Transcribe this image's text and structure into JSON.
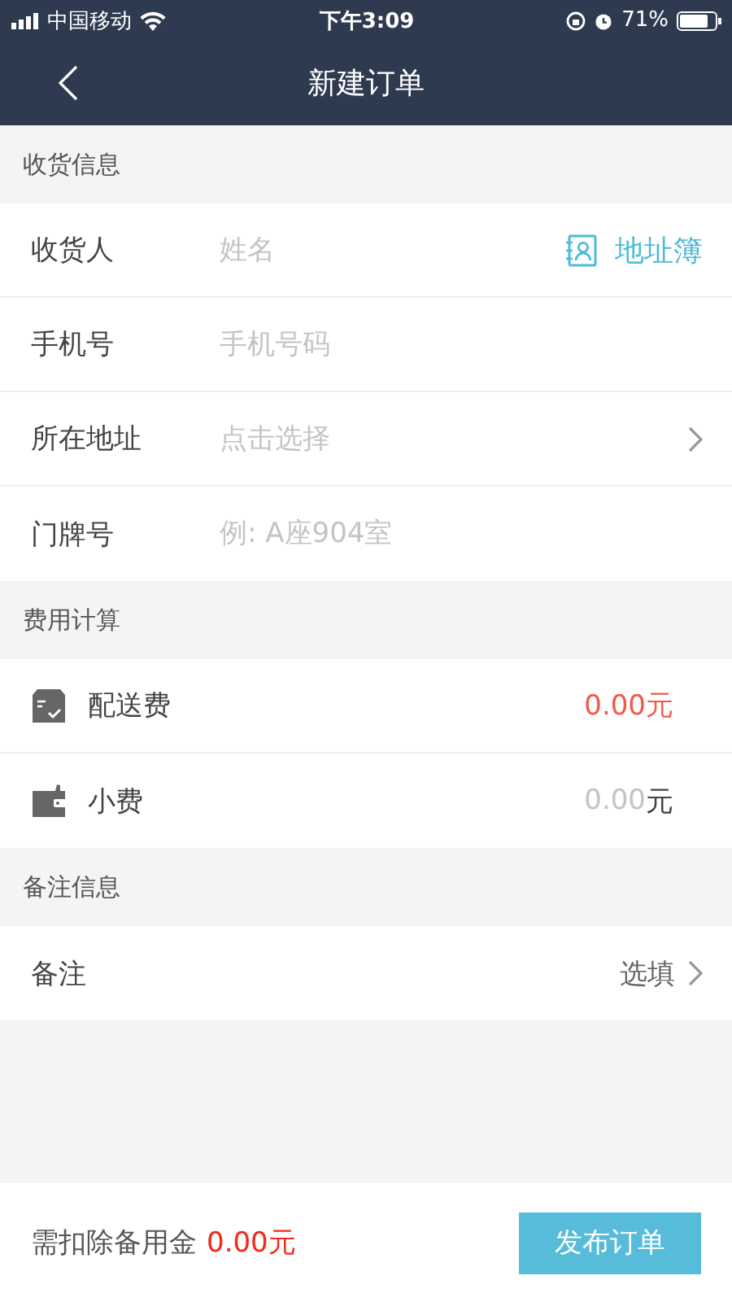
{
  "status_bar": {
    "carrier": "中国移动",
    "time": "下午3:09",
    "battery": "71%"
  },
  "nav": {
    "title": "新建订单"
  },
  "sections": [
    {
      "title": "收货信息",
      "rows": [
        {
          "kind": "input",
          "label": "收货人",
          "placeholder": "姓名",
          "action": "地址簿"
        },
        {
          "kind": "input",
          "label": "手机号",
          "placeholder": "手机号码"
        },
        {
          "kind": "select",
          "label": "所在地址",
          "placeholder": "点击选择"
        },
        {
          "kind": "input",
          "label": "门牌号",
          "placeholder": "例: A座904室"
        }
      ]
    },
    {
      "title": "费用计算",
      "rows": [
        {
          "kind": "charge",
          "label": "配送费",
          "value": "0.00元"
        },
        {
          "kind": "tip",
          "label": "小费",
          "placeholder": "0.00",
          "unit": "元"
        }
      ]
    },
    {
      "title": "备注信息",
      "rows": [
        {
          "kind": "option",
          "label": "备注",
          "value": "选填"
        }
      ]
    }
  ],
  "footer": {
    "label": "需扣除备用金",
    "amount": "0.00元",
    "button": "发布订单"
  }
}
